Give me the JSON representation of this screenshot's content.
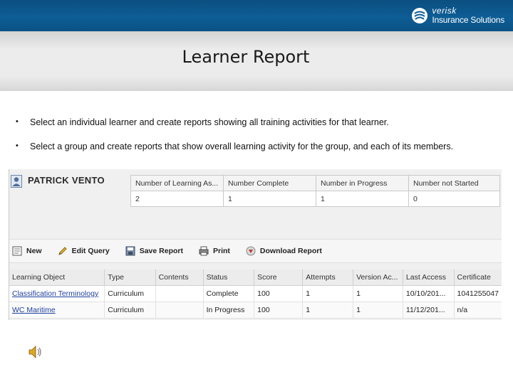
{
  "brand": {
    "name_line1": "verisk",
    "name_line2": "Insurance Solutions",
    "bar_color": "#0d5d95"
  },
  "slide": {
    "title": "Learner Report",
    "bullets": [
      "Select an individual learner and create reports showing all training activities for that learner.",
      "Select a group and create reports that show overall learning activity for the group, and each of its members."
    ]
  },
  "learner": {
    "name": "PATRICK VENTO",
    "summary_headers": [
      "Number of Learning As...",
      "Number Complete",
      "Number in Progress",
      "Number not Started"
    ],
    "summary_values": [
      "2",
      "1",
      "1",
      "0"
    ]
  },
  "toolbar": {
    "new_label": "New",
    "edit_query_label": "Edit Query",
    "save_report_label": "Save Report",
    "print_label": "Print",
    "download_report_label": "Download Report"
  },
  "grid": {
    "headers": [
      "Learning Object",
      "Type",
      "Contents",
      "Status",
      "Score",
      "Attempts",
      "Version Ac...",
      "Last Access",
      "Certificate"
    ],
    "rows": [
      [
        "Classification Terminology",
        "Curriculum",
        "",
        "Complete",
        "100",
        "1",
        "1",
        "10/10/201...",
        "1041255047"
      ],
      [
        "WC Maritime",
        "Curriculum",
        "",
        "In Progress",
        "100",
        "1",
        "1",
        "11/12/201...",
        "n/a"
      ]
    ]
  },
  "icons": {
    "person": "person-icon",
    "new": "new-document-icon",
    "edit": "pencil-icon",
    "save": "save-icon",
    "print": "printer-icon",
    "download": "download-icon",
    "speaker": "speaker-icon"
  }
}
